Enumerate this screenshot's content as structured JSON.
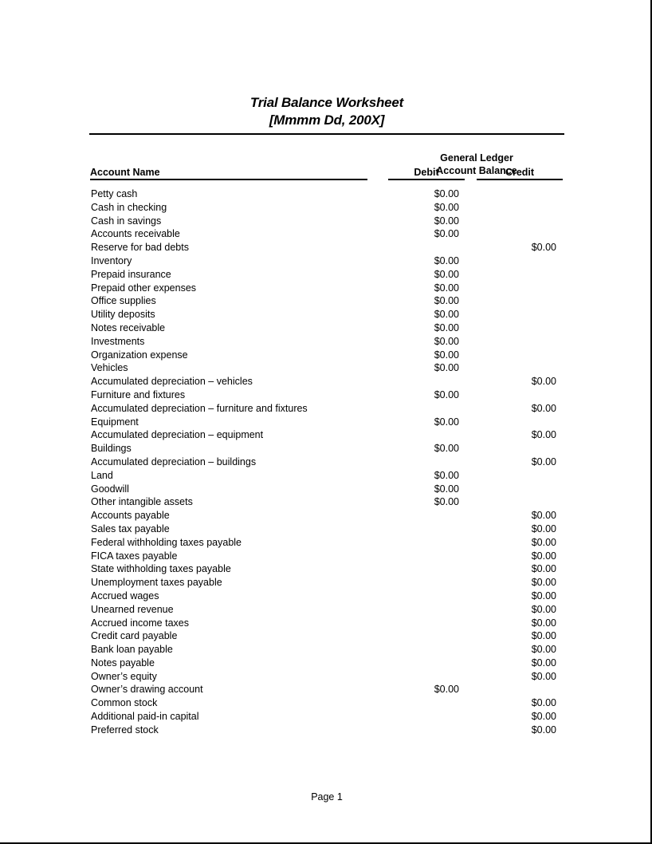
{
  "document": {
    "title": "Trial Balance Worksheet",
    "subtitle": "[Mmmm Dd, 200X]",
    "footer": "Page 1"
  },
  "table": {
    "group_header": {
      "line1": "General Ledger",
      "line2": "Account Balance"
    },
    "columns": {
      "account_name": "Account Name",
      "debit": "Debit",
      "credit": "Credit"
    },
    "rows": [
      {
        "account": "Petty cash",
        "debit": "$0.00",
        "credit": ""
      },
      {
        "account": "Cash in checking",
        "debit": "$0.00",
        "credit": ""
      },
      {
        "account": "Cash in savings",
        "debit": "$0.00",
        "credit": ""
      },
      {
        "account": "Accounts receivable",
        "debit": "$0.00",
        "credit": ""
      },
      {
        "account": "Reserve for bad debts",
        "debit": "",
        "credit": "$0.00"
      },
      {
        "account": "Inventory",
        "debit": "$0.00",
        "credit": ""
      },
      {
        "account": "Prepaid insurance",
        "debit": "$0.00",
        "credit": ""
      },
      {
        "account": "Prepaid other expenses",
        "debit": "$0.00",
        "credit": ""
      },
      {
        "account": "Office supplies",
        "debit": "$0.00",
        "credit": ""
      },
      {
        "account": "Utility deposits",
        "debit": "$0.00",
        "credit": ""
      },
      {
        "account": "Notes receivable",
        "debit": "$0.00",
        "credit": ""
      },
      {
        "account": "Investments",
        "debit": "$0.00",
        "credit": ""
      },
      {
        "account": "Organization expense",
        "debit": "$0.00",
        "credit": ""
      },
      {
        "account": "Vehicles",
        "debit": "$0.00",
        "credit": ""
      },
      {
        "account": "Accumulated depreciation – vehicles",
        "debit": "",
        "credit": "$0.00"
      },
      {
        "account": "Furniture and fixtures",
        "debit": "$0.00",
        "credit": ""
      },
      {
        "account": "Accumulated depreciation – furniture and fixtures",
        "debit": "",
        "credit": "$0.00"
      },
      {
        "account": "Equipment",
        "debit": "$0.00",
        "credit": ""
      },
      {
        "account": "Accumulated depreciation – equipment",
        "debit": "",
        "credit": "$0.00"
      },
      {
        "account": "Buildings",
        "debit": "$0.00",
        "credit": ""
      },
      {
        "account": "Accumulated depreciation – buildings",
        "debit": "",
        "credit": "$0.00"
      },
      {
        "account": "Land",
        "debit": "$0.00",
        "credit": ""
      },
      {
        "account": "Goodwill",
        "debit": "$0.00",
        "credit": ""
      },
      {
        "account": "Other intangible assets",
        "debit": "$0.00",
        "credit": ""
      },
      {
        "account": "Accounts payable",
        "debit": "",
        "credit": "$0.00"
      },
      {
        "account": "Sales tax payable",
        "debit": "",
        "credit": "$0.00"
      },
      {
        "account": "Federal withholding taxes payable",
        "debit": "",
        "credit": "$0.00"
      },
      {
        "account": "FICA taxes payable",
        "debit": "",
        "credit": "$0.00"
      },
      {
        "account": "State withholding taxes payable",
        "debit": "",
        "credit": "$0.00"
      },
      {
        "account": "Unemployment taxes payable",
        "debit": "",
        "credit": "$0.00"
      },
      {
        "account": "Accrued wages",
        "debit": "",
        "credit": "$0.00"
      },
      {
        "account": "Unearned revenue",
        "debit": "",
        "credit": "$0.00"
      },
      {
        "account": "Accrued income taxes",
        "debit": "",
        "credit": "$0.00"
      },
      {
        "account": "Credit card payable",
        "debit": "",
        "credit": "$0.00"
      },
      {
        "account": "Bank loan payable",
        "debit": "",
        "credit": "$0.00"
      },
      {
        "account": "Notes payable",
        "debit": "",
        "credit": "$0.00"
      },
      {
        "account": "Owner’s equity",
        "debit": "",
        "credit": "$0.00"
      },
      {
        "account": "Owner’s drawing account",
        "debit": "$0.00",
        "credit": ""
      },
      {
        "account": "Common stock",
        "debit": "",
        "credit": "$0.00"
      },
      {
        "account": "Additional paid-in capital",
        "debit": "",
        "credit": "$0.00"
      },
      {
        "account": "Preferred stock",
        "debit": "",
        "credit": "$0.00"
      }
    ]
  }
}
